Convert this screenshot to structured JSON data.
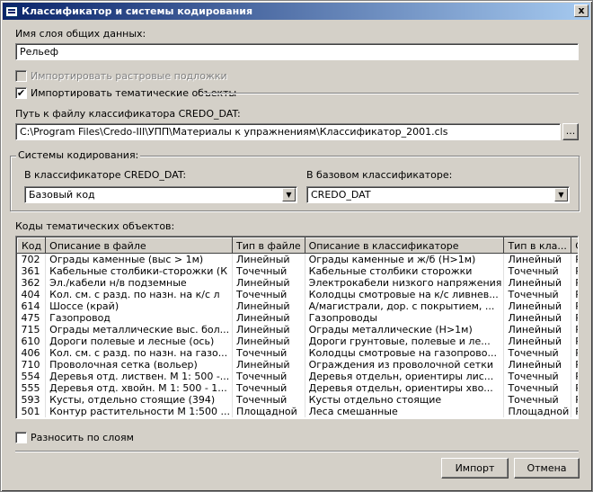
{
  "window": {
    "title": "Классификатор и системы кодирования",
    "close": "x"
  },
  "layer_name": {
    "label": "Имя слоя общих данных:",
    "value": "Рельеф"
  },
  "import_raster": {
    "label": "Импортировать растровые подложки",
    "checked": false,
    "enabled": false
  },
  "import_thematic": {
    "label": "Импортировать тематические объекты",
    "checked": true
  },
  "classifier_path": {
    "label": "Путь к файлу классификатора CREDO_DAT:",
    "value": "C:\\Program Files\\Credo-III\\УПП\\Материалы к упражнениям\\Классификатор_2001.cls",
    "browse": "..."
  },
  "coding": {
    "legend": "Системы кодирования:",
    "in_classifier_label": "В классификаторе CREDO_DAT:",
    "in_classifier_value": "Базовый код",
    "base_label": "В базовом классификаторе:",
    "base_value": "CREDO_DAT"
  },
  "codes_table": {
    "label": "Коды тематических объектов:",
    "columns": [
      "Код",
      "Описание в файле",
      "Тип в файле",
      "Описание в классификаторе",
      "Тип в кла...",
      "Слой"
    ],
    "rows": [
      [
        "702",
        "Ограды каменные (выс > 1м)",
        "Линейный",
        "Ограды каменные и ж/б (Н>1м)",
        "Линейный",
        "Рельеф"
      ],
      [
        "361",
        "Кабельные столбики-сторожки (К",
        "Точечный",
        "Кабельные столбики сторожки",
        "Точечный",
        "Рельеф"
      ],
      [
        "362",
        "Эл./кабели н/в подземные",
        "Линейный",
        "Электрокабели низкого напряжения",
        "Линейный",
        "Рельеф"
      ],
      [
        "404",
        "Кол. см. с разд. по назн. на к/с л",
        "Точечный",
        "Колодцы смотровые на к/с ливнев...",
        "Точечный",
        "Рельеф"
      ],
      [
        "614",
        "Шоссе (край)",
        "Линейный",
        "А/магистрали, дор. с покрытием, ...",
        "Линейный",
        "Рельеф"
      ],
      [
        "475",
        "Газопровод",
        "Линейный",
        "Газопроводы",
        "Линейный",
        "Рельеф"
      ],
      [
        "715",
        "Ограды металлические выс. бол...",
        "Линейный",
        "Ограды металлические (Н>1м)",
        "Линейный",
        "Рельеф"
      ],
      [
        "610",
        "Дороги полевые и лесные (ось)",
        "Линейный",
        "Дороги  грунтовые, полевые и ле...",
        "Линейный",
        "Рельеф"
      ],
      [
        "406",
        "Кол. см. с разд. по назн. на газо...",
        "Точечный",
        "Колодцы смотровые на газопрово...",
        "Точечный",
        "Рельеф"
      ],
      [
        "710",
        "Проволочная сетка (вольер)",
        "Линейный",
        "Ограждения из проволочной сетки",
        "Линейный",
        "Рельеф"
      ],
      [
        "554",
        "Деревья отд. листвен. М 1: 500 -...",
        "Точечный",
        "Деревья отдельн, ориентиры лис...",
        "Точечный",
        "Рельеф"
      ],
      [
        "555",
        "Деревья отд. хвойн. М 1: 500 - 1...",
        "Точечный",
        "Деревья отдельн, ориентиры хво...",
        "Точечный",
        "Рельеф"
      ],
      [
        "593",
        "Кусты, отдельно стоящие (394)",
        "Точечный",
        "Кусты отдельно стоящие",
        "Точечный",
        "Рельеф"
      ],
      [
        "501",
        "Контур растительности М 1:500 ...",
        "Площадной",
        "Леса смешанные",
        "Площадной",
        "Рельеф"
      ]
    ]
  },
  "split_layers": {
    "label": "Разносить по слоям",
    "checked": false
  },
  "buttons": {
    "import": "Импорт",
    "cancel": "Отмена"
  },
  "colors": {
    "titlebar_start": "#0a246a",
    "titlebar_end": "#a6caf0",
    "face": "#d4d0c8"
  }
}
